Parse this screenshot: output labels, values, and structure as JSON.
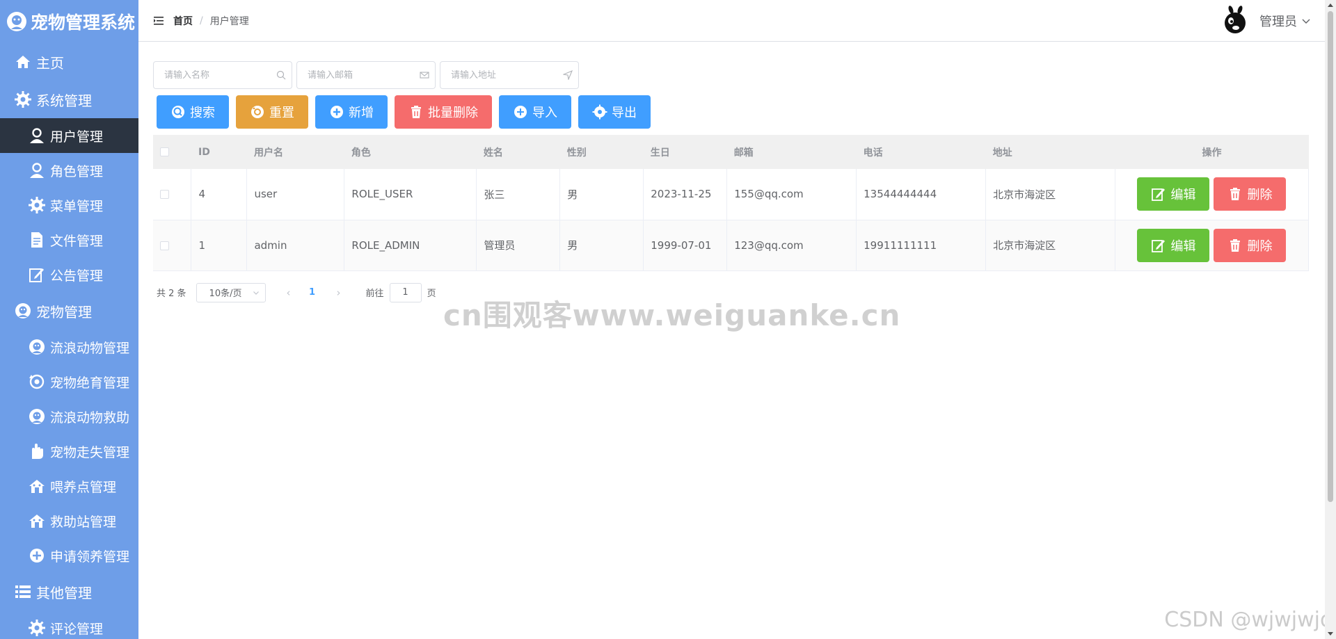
{
  "app": {
    "title": "宠物管理系统"
  },
  "sidebar": {
    "items": [
      {
        "label": "主页",
        "level": "top",
        "icon": "home-icon"
      },
      {
        "label": "系统管理",
        "level": "top",
        "icon": "gear-icon"
      },
      {
        "label": "用户管理",
        "level": "sub",
        "icon": "user-icon",
        "active": true
      },
      {
        "label": "角色管理",
        "level": "sub",
        "icon": "user-icon"
      },
      {
        "label": "菜单管理",
        "level": "sub",
        "icon": "gear-icon"
      },
      {
        "label": "文件管理",
        "level": "sub",
        "icon": "document-icon"
      },
      {
        "label": "公告管理",
        "level": "sub",
        "icon": "edit-icon"
      },
      {
        "label": "宠物管理",
        "level": "top",
        "icon": "pet-icon"
      },
      {
        "label": "流浪动物管理",
        "level": "sub",
        "icon": "pet-icon"
      },
      {
        "label": "宠物绝育管理",
        "level": "sub",
        "icon": "refresh-icon"
      },
      {
        "label": "流浪动物救助",
        "level": "sub",
        "icon": "pet-icon"
      },
      {
        "label": "宠物走失管理",
        "level": "sub",
        "icon": "hand-icon"
      },
      {
        "label": "喂养点管理",
        "level": "sub",
        "icon": "house-icon"
      },
      {
        "label": "救助站管理",
        "level": "sub",
        "icon": "house-icon"
      },
      {
        "label": "申请领养管理",
        "level": "sub",
        "icon": "plus-circle-icon"
      },
      {
        "label": "其他管理",
        "level": "top",
        "icon": "list-icon"
      },
      {
        "label": "评论管理",
        "level": "sub",
        "icon": "gear-icon"
      }
    ]
  },
  "header": {
    "breadcrumb": {
      "home": "首页",
      "separator": "/",
      "current": "用户管理"
    },
    "user": {
      "name": "管理员"
    }
  },
  "filters": {
    "name_placeholder": "请输入名称",
    "email_placeholder": "请输入邮箱",
    "address_placeholder": "请输入地址"
  },
  "toolbar": {
    "search": "搜索",
    "reset": "重置",
    "add": "新增",
    "batch_delete": "批量删除",
    "import": "导入",
    "export": "导出"
  },
  "table": {
    "columns": [
      "ID",
      "用户名",
      "角色",
      "姓名",
      "性别",
      "生日",
      "邮箱",
      "电话",
      "地址",
      "操作"
    ],
    "rows": [
      {
        "id": "4",
        "username": "user",
        "role": "ROLE_USER",
        "name": "张三",
        "gender": "男",
        "birthday": "2023-11-25",
        "email": "155@qq.com",
        "phone": "13544444444",
        "address": "北京市海淀区"
      },
      {
        "id": "1",
        "username": "admin",
        "role": "ROLE_ADMIN",
        "name": "管理员",
        "gender": "男",
        "birthday": "1999-07-01",
        "email": "123@qq.com",
        "phone": "19911111111",
        "address": "北京市海淀区"
      }
    ],
    "edit_label": "编辑",
    "delete_label": "删除"
  },
  "pagination": {
    "total": "共 2 条",
    "page_size": "10条/页",
    "prev": "‹",
    "next": "›",
    "current_page": "1",
    "goto_label": "前往",
    "goto_value": "1",
    "page_suffix": "页"
  },
  "watermarks": {
    "center": "cn围观客www.weiguanke.cn",
    "corner": "CSDN @wjwjwjd"
  },
  "colors": {
    "sidebar_bg": "#6e9ee8",
    "sidebar_active": "#2b3441",
    "primary": "#409eff",
    "warning": "#e6a23c",
    "danger": "#f56c6c",
    "success": "#67c23a"
  }
}
